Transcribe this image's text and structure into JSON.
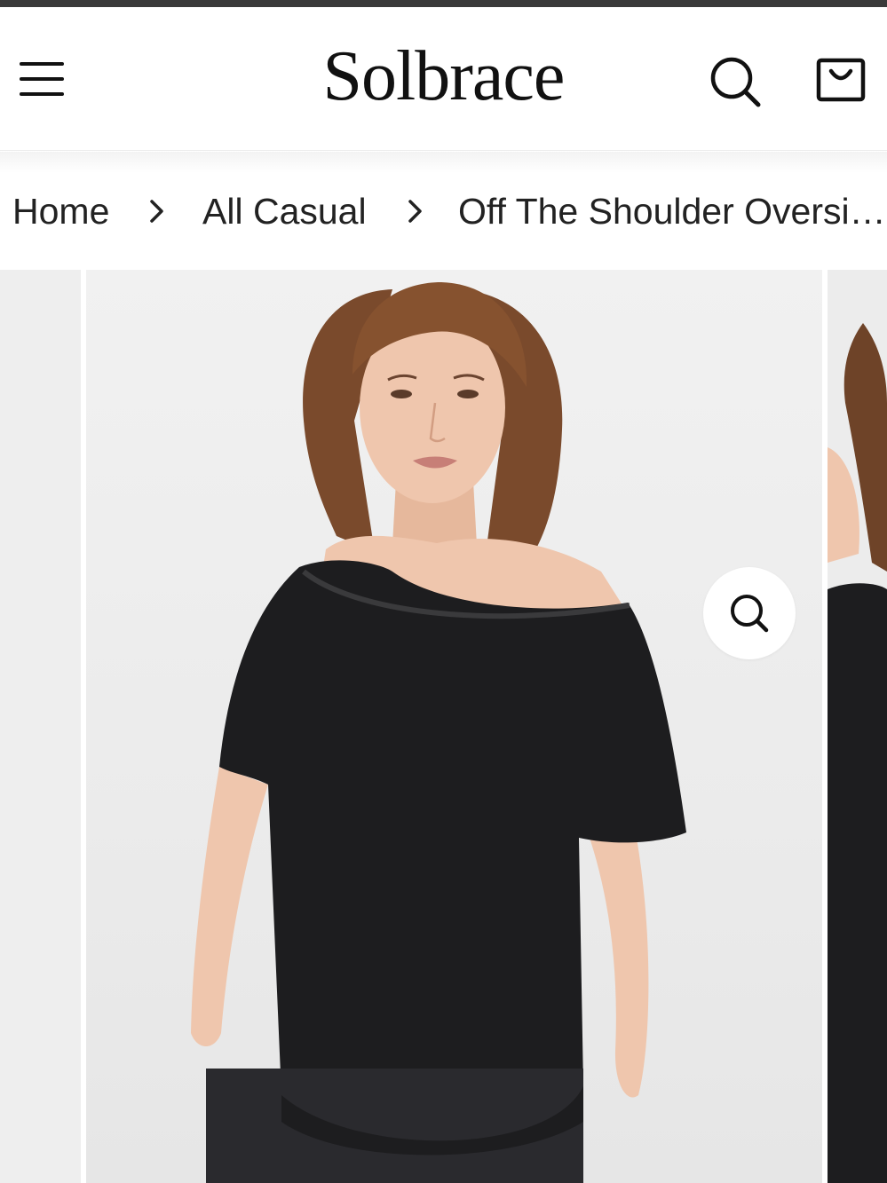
{
  "header": {
    "brand": "Solbrace",
    "menu_icon": "hamburger-menu-icon",
    "search_icon": "search-icon",
    "cart_icon": "shopping-bag-icon"
  },
  "breadcrumb": {
    "items": [
      {
        "label": "Home"
      },
      {
        "label": "All Casual"
      },
      {
        "label": "Off The Shoulder Oversi…"
      }
    ],
    "separator_icon": "chevron-right-icon"
  },
  "gallery": {
    "zoom_icon": "zoom-icon",
    "main_image_alt": "Off the shoulder oversized black t-shirt"
  },
  "colors": {
    "top_strip": "#3a3a3a",
    "text": "#111111",
    "background": "#ffffff",
    "product": "#1d1d1f"
  }
}
